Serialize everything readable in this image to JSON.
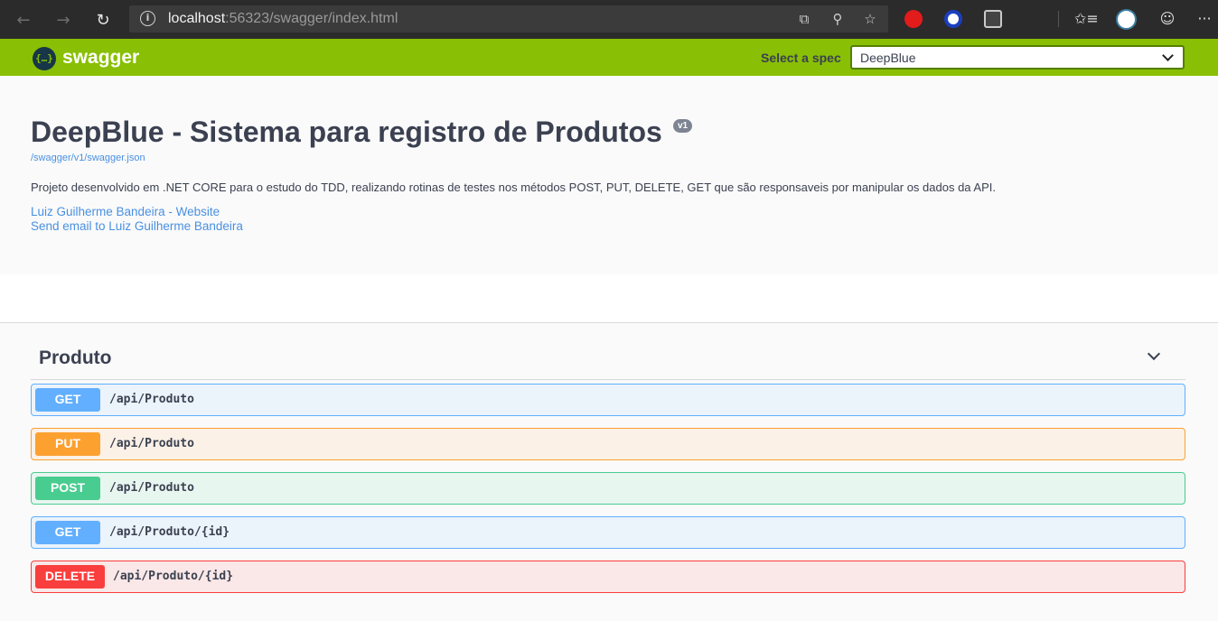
{
  "browser": {
    "back_icon": "←",
    "forward_icon": "→",
    "reload_icon": "↻",
    "info_icon": "i",
    "url_host": "localhost",
    "url_rest": ":56323/swagger/index.html",
    "reader_icon": "⧉",
    "zoom_icon": "⚲",
    "favorite_icon": "☆",
    "favorites_bar_icon": "✩≡",
    "emoji_icon": "☺",
    "more_icon": "···"
  },
  "topbar": {
    "logo_symbol": "{…}",
    "logo_text": "swagger",
    "select_label": "Select a spec",
    "selected_spec": "DeepBlue"
  },
  "info": {
    "title": "DeepBlue - Sistema para registro de Produtos",
    "version": "v1",
    "spec_url": "/swagger/v1/swagger.json",
    "description": "Projeto desenvolvido em .NET CORE para o estudo do TDD, realizando rotinas de testes nos métodos POST, PUT, DELETE, GET que são responsaveis por manipular os dados da API.",
    "website_link": "Luiz Guilherme Bandeira - Website",
    "email_link": "Send email to Luiz Guilherme Bandeira"
  },
  "tag": {
    "name": "Produto",
    "operations": [
      {
        "method": "GET",
        "path": "/api/Produto"
      },
      {
        "method": "PUT",
        "path": "/api/Produto"
      },
      {
        "method": "POST",
        "path": "/api/Produto"
      },
      {
        "method": "GET",
        "path": "/api/Produto/{id}"
      },
      {
        "method": "DELETE",
        "path": "/api/Produto/{id}"
      }
    ]
  },
  "colors": {
    "topbar": "#89bf04",
    "get": "#61affe",
    "put": "#fca130",
    "post": "#49cc90",
    "delete": "#f93e3e"
  }
}
